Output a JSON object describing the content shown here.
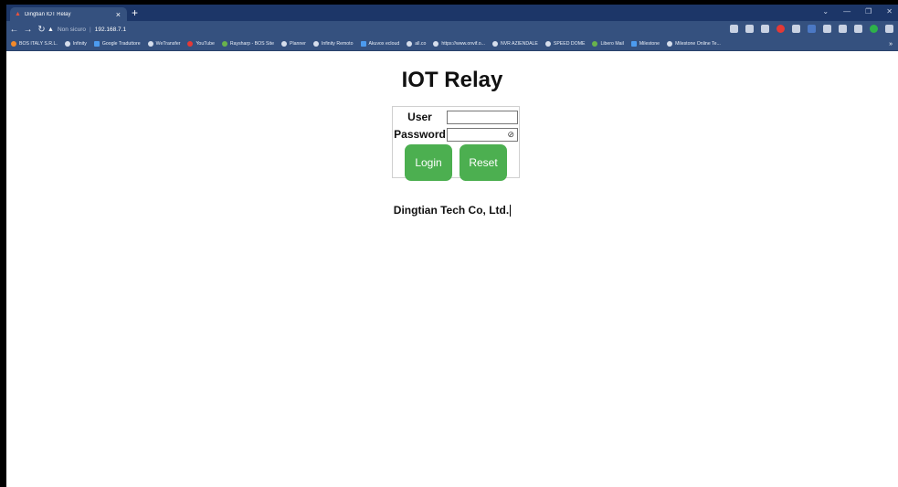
{
  "browser": {
    "tab_title": "Dingtian IOT Relay",
    "tab_close": "×",
    "new_tab": "+",
    "security_label": "Non sicuro",
    "url": "192.168.7.1"
  },
  "bookmarks": [
    "BOS ITALY S.R.L.",
    "Infinity",
    "Google Traduttore",
    "WeTransfer",
    "YouTube",
    "Raysharp - BOS Site",
    "Planner",
    "Infinity Remoto",
    "Akuvox ecloud",
    "all.co",
    "https://www.onvif.o...",
    "NVR AZIENDALE",
    "SPEED DOME",
    "Libero Mail",
    "Milestone",
    "Milestone Online Te..."
  ],
  "page": {
    "title": "IOT Relay",
    "user_label": "User",
    "password_label": "Password",
    "login_button": "Login",
    "reset_button": "Reset",
    "footer": "Dingtian Tech Co, Ltd."
  },
  "colors": {
    "button": "#4caf50",
    "browser_chrome": "#35517f"
  }
}
